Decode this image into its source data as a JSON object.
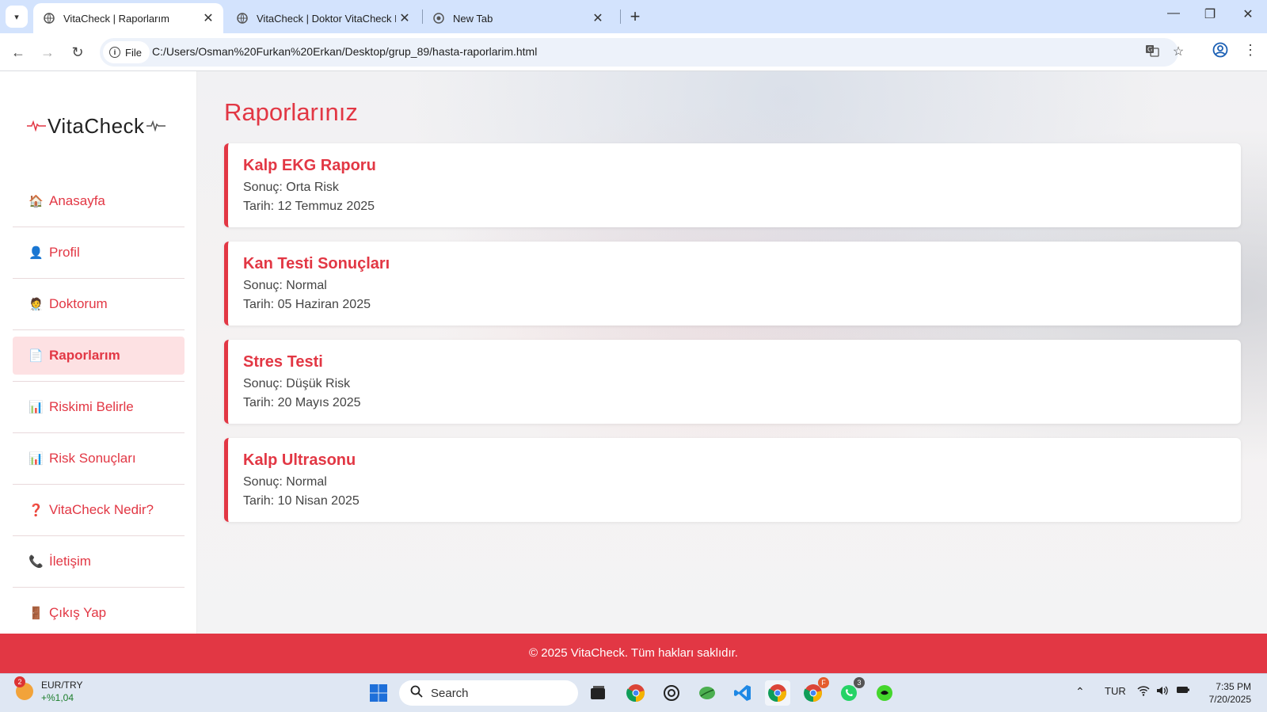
{
  "browser": {
    "tabs": [
      {
        "title": "VitaCheck | Raporlarım",
        "active": true
      },
      {
        "title": "VitaCheck | Doktor VitaCheck N",
        "active": false
      },
      {
        "title": "New Tab",
        "active": false
      }
    ],
    "file_chip": "File",
    "url": "C:/Users/Osman%20Furkan%20Erkan/Desktop/grup_89/hasta-raporlarim.html"
  },
  "sidebar": {
    "logo": "VitaCheck",
    "items": [
      {
        "label": "Anasayfa",
        "icon": "home-icon",
        "glyph": "🏠"
      },
      {
        "label": "Profil",
        "icon": "user-icon",
        "glyph": "👤"
      },
      {
        "label": "Doktorum",
        "icon": "doctor-icon",
        "glyph": "🧑‍⚕️"
      },
      {
        "label": "Raporlarım",
        "icon": "document-icon",
        "glyph": "📄",
        "active": true
      },
      {
        "label": "Riskimi Belirle",
        "icon": "chart-icon",
        "glyph": "📊"
      },
      {
        "label": "Risk Sonuçları",
        "icon": "chart-icon",
        "glyph": "📊"
      },
      {
        "label": "VitaCheck Nedir?",
        "icon": "question-icon",
        "glyph": "❓"
      },
      {
        "label": "İletişim",
        "icon": "phone-icon",
        "glyph": "📞"
      },
      {
        "label": "Çıkış Yap",
        "icon": "door-icon",
        "glyph": "🚪"
      }
    ]
  },
  "main": {
    "title": "Raporlarınız",
    "reports": [
      {
        "title": "Kalp EKG Raporu",
        "result": "Sonuç: Orta Risk",
        "date": "Tarih: 12 Temmuz 2025"
      },
      {
        "title": "Kan Testi Sonuçları",
        "result": "Sonuç: Normal",
        "date": "Tarih: 05 Haziran 2025"
      },
      {
        "title": "Stres Testi",
        "result": "Sonuç: Düşük Risk",
        "date": "Tarih: 20 Mayıs 2025"
      },
      {
        "title": "Kalp Ultrasonu",
        "result": "Sonuç: Normal",
        "date": "Tarih: 10 Nisan 2025"
      }
    ]
  },
  "footer": {
    "text": "© 2025 VitaCheck. Tüm hakları saklıdır."
  },
  "taskbar": {
    "widget_badge": "2",
    "currency_pair": "EUR/TRY",
    "currency_change": "+%1,04",
    "search_placeholder": "Search",
    "language": "TUR",
    "time": "7:35 PM",
    "date": "7/20/2025",
    "whatsapp_badge": "3",
    "app_badge": "F"
  },
  "colors": {
    "brand": "#e23744",
    "active_bg": "#fde1e3"
  }
}
